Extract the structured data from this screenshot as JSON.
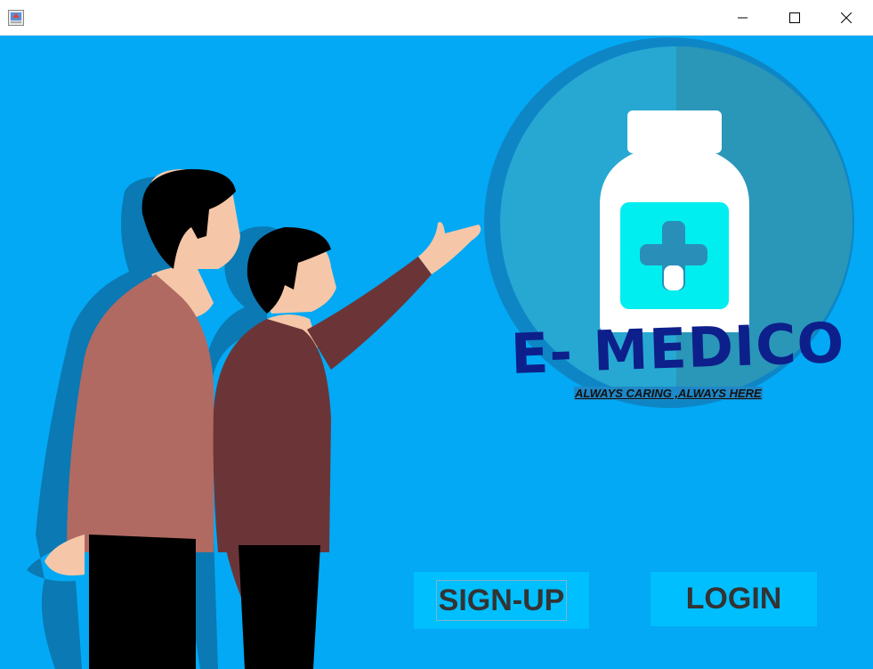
{
  "window": {
    "app_icon": "java-app-icon",
    "controls": [
      "minimize-icon",
      "maximize-icon",
      "close-icon"
    ]
  },
  "brand": {
    "name": "E- MEDICO",
    "tagline": "ALWAYS CARING ,ALWAYS HERE",
    "logo": "medicine-bottle-icon"
  },
  "actions": {
    "signup_label": "SIGN-UP",
    "login_label": "LOGIN"
  },
  "colors": {
    "background": "#03a9f4",
    "button": "#00bfff",
    "brand_text": "#0d1f8a",
    "bottle_label": "#00e5ee"
  }
}
